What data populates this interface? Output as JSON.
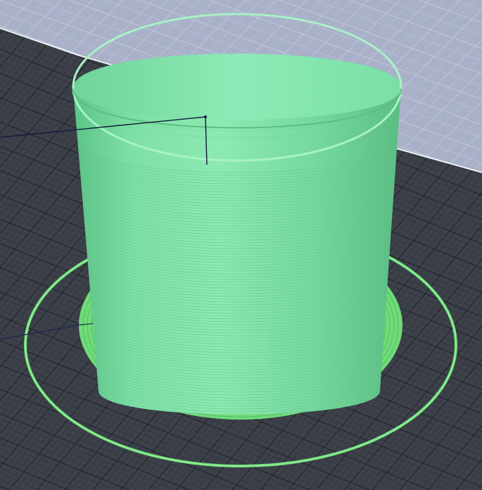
{
  "viewport": {
    "description_free": true,
    "colors": {
      "background_void": "#2e3136",
      "bed_plate": "#3d414a",
      "bed_grid_minor": "#2a2d33",
      "bed_grid_major": "#1f2126",
      "wall_plane": "#a8b0c8",
      "wall_grid": "#c6cce0",
      "print_body": "#72dc9c",
      "print_body_light": "#8ae8b0",
      "print_body_shadow": "#55b87c",
      "print_rim": "#a6f0c2",
      "brim": "#6fe07a",
      "brim_dark": "#58c466",
      "skirt": "#6fe07a",
      "travel_move": "#141a3a"
    },
    "icons": [
      "print-object",
      "skirt-ring",
      "brim-ring",
      "travel-path"
    ]
  }
}
